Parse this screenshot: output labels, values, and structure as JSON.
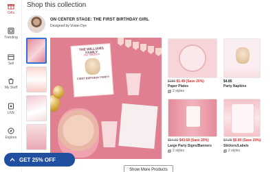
{
  "nav": {
    "items": [
      {
        "label": "Gifts",
        "icon": "gift-icon",
        "active": true
      },
      {
        "label": "Trending",
        "icon": "trending-icon"
      },
      {
        "label": "Sell",
        "icon": "sell-icon"
      },
      {
        "label": "My Stuff",
        "icon": "my-stuff-icon"
      },
      {
        "label": "LIVE",
        "icon": "live-icon"
      },
      {
        "label": "Explore",
        "icon": "explore-icon"
      }
    ]
  },
  "section_title": "Shop this collection",
  "collection": {
    "title": "ON CENTER STAGE: THE FIRST BIRTHDAY GIRL",
    "designer": "Designed by Vivian Dye"
  },
  "main_image": {
    "invite_title": "THE WILLIAMS FAMILY",
    "invite_subtitle": "Our Madison",
    "invite_line": "FIRST BIRTHDAY PARTY"
  },
  "products": [
    {
      "name": "Paper Plates",
      "price_old": "$185",
      "price_new": "$1.49",
      "sale": "(Save 20%)",
      "styles": "2 styles"
    },
    {
      "name": "Party Napkins",
      "price_new": "$4.85",
      "price_old": "",
      "sale": "",
      "styles": ""
    },
    {
      "name": "Large Party Signs/Banners",
      "price_old": "$54.60",
      "price_new": "$43.68",
      "sale": "(Save 20%)",
      "styles": "2 styles"
    },
    {
      "name": "Stickers/Labels",
      "price_old": "$7.25",
      "price_new": "$5.80",
      "sale": "(Save 20%)",
      "styles": "2 styles"
    }
  ],
  "promo": {
    "label": "GET 25% OFF"
  },
  "show_more": "Show More Products",
  "colors": {
    "brand_blue": "#1f4f9e",
    "sale_red": "#d32f2f",
    "selected_outline": "#2f6fd6",
    "nav_active": "#c74a4a"
  }
}
